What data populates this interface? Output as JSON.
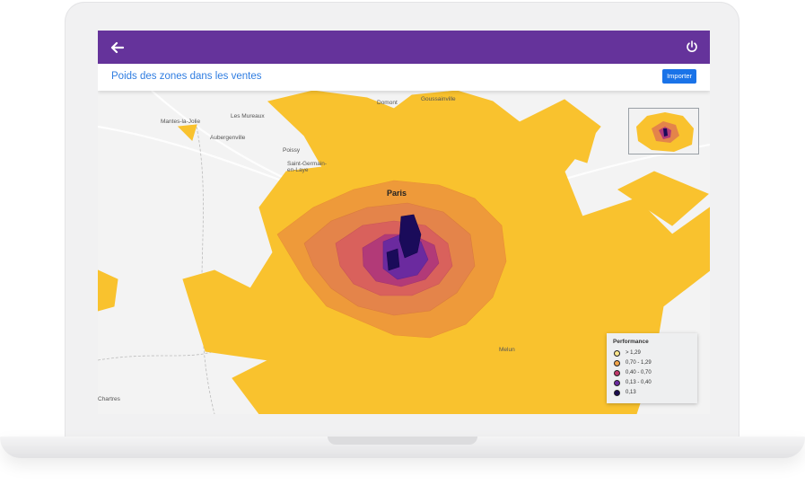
{
  "app": {
    "title": "Poids des zones dans les ventes",
    "import_label": "Importer"
  },
  "icons": {
    "back": "arrow-left-icon",
    "power": "power-icon"
  },
  "colors": {
    "topbar": "#65339b",
    "title": "#2f7de1",
    "button": "#1a73e8"
  },
  "map": {
    "paris_label": "Paris",
    "cities": [
      "Mantes-la-Jolie",
      "Les Mureaux",
      "Aubergenville",
      "Poissy",
      "Saint-Germain-en-Laye",
      "Domont",
      "Goussainville",
      "Melun",
      "Chartres"
    ]
  },
  "legend": {
    "title": "Performance",
    "items": [
      {
        "label": "> 1,29",
        "color": "#fbe68c"
      },
      {
        "label": "0,70 - 1,29",
        "color": "#f2a54a"
      },
      {
        "label": "0,40 - 0,70",
        "color": "#c0396b"
      },
      {
        "label": "0,13 - 0,40",
        "color": "#6a2a9e"
      },
      {
        "label": "0,13",
        "color": "#1a0b50"
      }
    ]
  }
}
